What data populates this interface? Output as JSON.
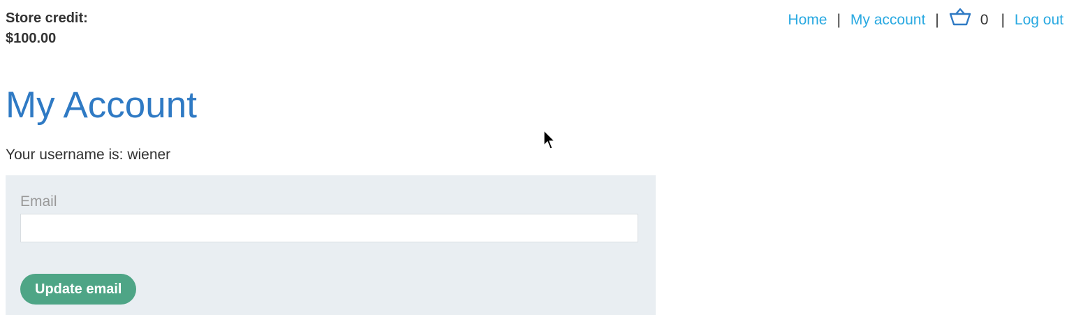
{
  "header": {
    "store_credit_label": "Store credit:",
    "store_credit_value": "$100.00"
  },
  "nav": {
    "home": "Home",
    "separator": "|",
    "my_account": "My account",
    "cart_icon": "basket-icon",
    "cart_count": "0",
    "log_out": "Log out"
  },
  "main": {
    "title": "My Account",
    "username_line": "Your username is: wiener"
  },
  "form": {
    "email_label": "Email",
    "email_value": "",
    "update_button_label": "Update email"
  },
  "colors": {
    "link": "#29a9e1",
    "title": "#2f7ac4",
    "button": "#4ea586",
    "panel": "#e9eef2"
  }
}
